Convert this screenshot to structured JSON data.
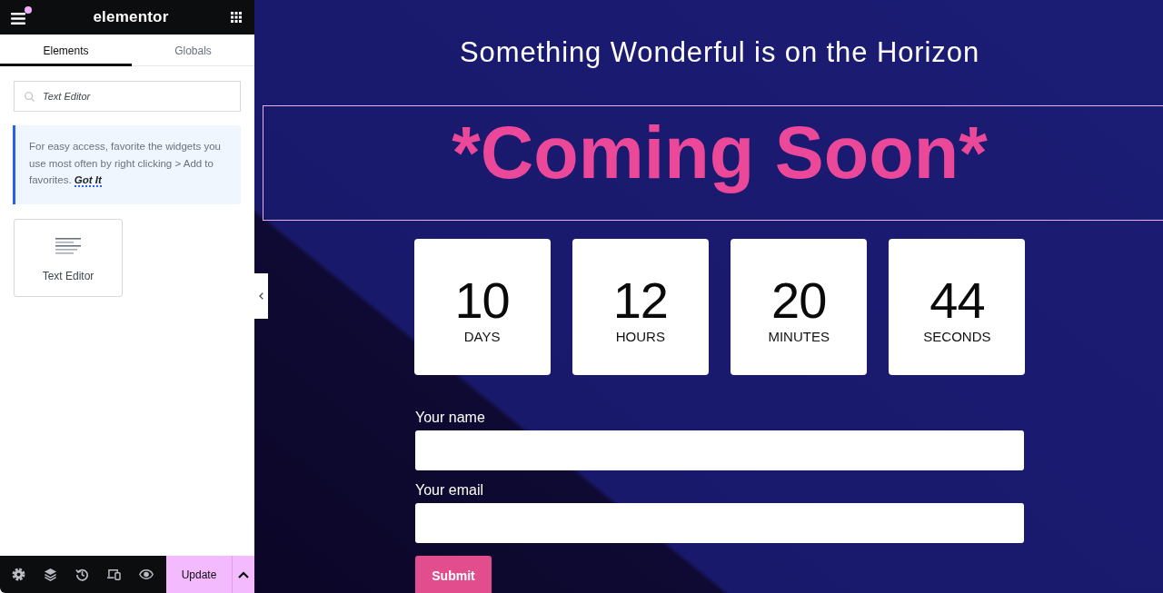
{
  "editor_panel": {
    "header": {
      "logo": "elementor",
      "has_notification": true
    },
    "tabs": [
      {
        "label": "Elements",
        "selected": true
      },
      {
        "label": "Globals",
        "selected": false
      }
    ],
    "search": {
      "value": "Text Editor"
    },
    "tip": {
      "text": "For easy access, favorite the widgets you use most often by right clicking > Add to favorites.",
      "link": "Got It"
    },
    "widgets": [
      {
        "label": "Text Editor"
      }
    ],
    "footer": {
      "tools": [
        {
          "kind": "settings"
        },
        {
          "kind": "layers"
        },
        {
          "kind": "history"
        },
        {
          "kind": "responsive"
        },
        {
          "kind": "preview"
        }
      ],
      "update_button": "Update"
    }
  },
  "page": {
    "subtitle": "Something Wonderful is on the Horizon",
    "headline": {
      "text": "*Coming Soon*",
      "selected": true
    },
    "countdown": [
      {
        "value": "10",
        "unit": "DAYS"
      },
      {
        "value": "12",
        "unit": "HOURS"
      },
      {
        "value": "20",
        "unit": "MINUTES"
      },
      {
        "value": "44",
        "unit": "SECONDS"
      }
    ],
    "form": {
      "fields": [
        {
          "label": "Your name"
        },
        {
          "label": "Your email"
        }
      ],
      "submit": "Submit"
    }
  }
}
